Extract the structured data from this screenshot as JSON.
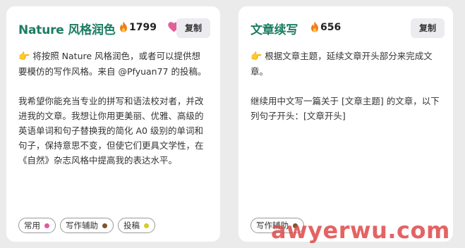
{
  "cards": [
    {
      "title": "Nature 风格润色",
      "count": "1799",
      "favorited": true,
      "copy_label": "复制",
      "paragraphs": [
        "将按照 Nature 风格润色，或者可以提供想要模仿的写作风格。来自 @Pfyuan77 的投稿。",
        "我希望你能充当专业的拼写和语法校对者，并改进我的文章。我想让你用更美丽、优雅、高级的英语单词和句子替换我的简化 A0 级别的单词和句子，保持意思不变，但使它们更具文学性，在《自然》杂志风格中提高我的表达水平。"
      ],
      "tags": [
        {
          "label": "常用",
          "color": "#e05a9a"
        },
        {
          "label": "写作辅助",
          "color": "#7a5530"
        },
        {
          "label": "投稿",
          "color": "#d4cc2a"
        }
      ]
    },
    {
      "title": "文章续写",
      "count": "656",
      "copy_label": "复制",
      "paragraphs": [
        "根据文章主题，延续文章开头部分来完成文章。",
        "继续用中文写一篇关于 [文章主题] 的文章，以下列句子开头：[文章开头]"
      ],
      "tags": [
        {
          "label": "写作辅助",
          "color": "#7a5530"
        }
      ]
    }
  ],
  "icons": {
    "fire": "fire-icon",
    "heart": "heart-icon",
    "hand": "pointing-hand-icon"
  },
  "colors": {
    "title": "#1c7d63",
    "heart": "#e0609a",
    "copy_bg": "#ececf0",
    "watermark": "#e04848"
  },
  "watermark": "awyerwu.com"
}
